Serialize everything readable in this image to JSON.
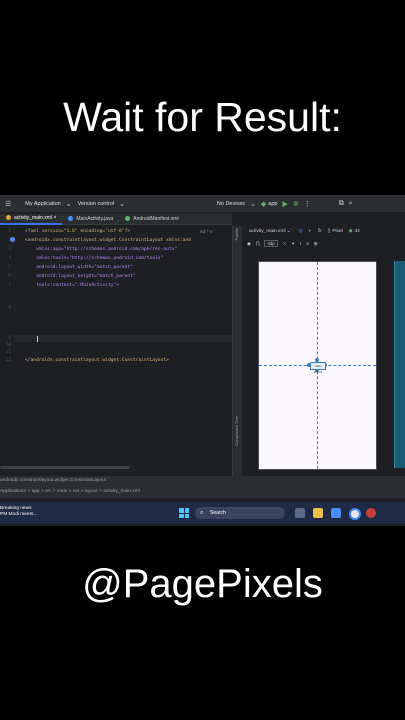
{
  "captions": {
    "top": "Wait for Result:",
    "bottom": "@PagePixels"
  },
  "toolbar": {
    "project": "My Application",
    "vcs": "Version control",
    "devices": "No Devices",
    "run_config": "app"
  },
  "tabs": [
    {
      "label": "activity_main.xml",
      "active": true,
      "color": "#e8a33d"
    },
    {
      "label": "MainActivity.java",
      "active": false,
      "color": "#4b8df8"
    },
    {
      "label": "AndroidManifest.xml",
      "active": false,
      "color": "#5fb865"
    }
  ],
  "editor": {
    "lines": [
      {
        "n": "1",
        "text": "<?xml version=\"1.0\" encoding=\"utf-8\"?>"
      },
      {
        "n": "2",
        "text": "<androidx.constraintlayout.widget.ConstraintLayout xmlns:and"
      },
      {
        "n": "3",
        "text": "    xmlns:app=\"http://schemas.android.com/apk/res-auto\""
      },
      {
        "n": "4",
        "text": "    xmlns:tools=\"http://schemas.android.com/tools\""
      },
      {
        "n": "5",
        "text": "    android:layout_width=\"match_parent\""
      },
      {
        "n": "6",
        "text": "    android:layout_height=\"match_parent\""
      },
      {
        "n": "7",
        "text": "    tools:context=\".MainActivity\">"
      },
      {
        "n": "8",
        "text": ""
      },
      {
        "n": "9",
        "text": ""
      },
      {
        "n": "10",
        "text": ""
      },
      {
        "n": "11",
        "text": ""
      },
      {
        "n": "12",
        "text": "</androidx.constraintlayout.widget.ConstraintLayout>"
      }
    ],
    "warnings": "A2 ^ v"
  },
  "design": {
    "file": "activity_main.xml",
    "device": "Pixel",
    "api": "34",
    "margin": "0dp",
    "side_label_palette": "Palette",
    "side_label_tree": "Component Tree",
    "hello_label": "Hello World!"
  },
  "statusbar": {
    "breadcrumb_tag": "androidx.constraintlayout.widget.ConstraintLayout",
    "path": "Application3 > app > src > main > res > layout > activity_main.xml"
  },
  "taskbar": {
    "news_title": "Breaking news",
    "news_sub": "PM Modi meets...",
    "search": "Search"
  },
  "colors": {
    "accent": "#3574f0",
    "canvas": "#fbf8ff",
    "guide": "#3d7cc0",
    "taskbar": "#1f2a45"
  }
}
